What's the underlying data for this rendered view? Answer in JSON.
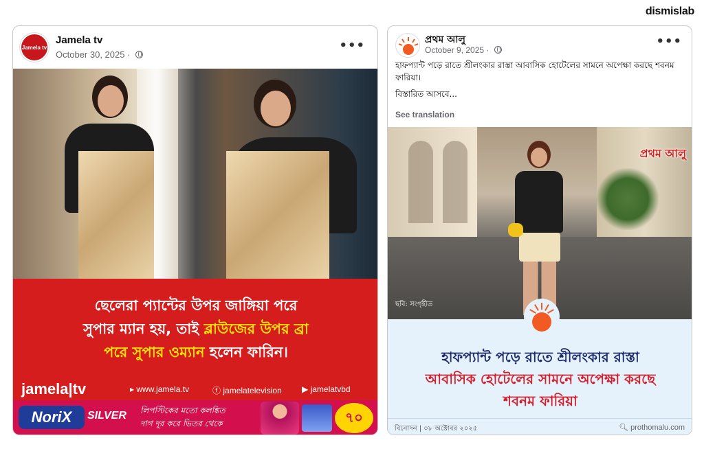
{
  "brand": "dismislab",
  "post1": {
    "page_name": "Jamela tv",
    "avatar_text": "Jamela tv",
    "date": "October 30, 2025",
    "more": "•••",
    "headline_lines": [
      [
        "ছেলেরা প্যান্টের উপর জাঙ্গিয়া পরে"
      ],
      [
        "সুপার ম্যান হয়, তাই ",
        "ব্লাউজের উপর ব্রা"
      ],
      [
        "পরে সুপার ওম্যান",
        " হলেন ফারিন।"
      ]
    ],
    "brand_bar": {
      "logo": "jamela|tv",
      "website": "www.jamela.tv",
      "facebook": "jamelatelevision",
      "youtube": "jamelatvbd"
    },
    "ad": {
      "brand": "NoriX",
      "variant": "SILVER",
      "tagline_1": "লিপস্টিকের মতো কলঙ্কিত",
      "tagline_2": "দাগ দূর করে ভিতর থেকে",
      "price": "৭০"
    }
  },
  "post2": {
    "page_name": "প্রথম আলু",
    "date": "October 9, 2025",
    "more": "•••",
    "caption": "হাফপ্যান্ট পড়ে রাতে শ্রীলংকার রাস্তা আবাসিক হোটেলের সামনে অপেক্ষা করছে শবনম ফারিয়া।",
    "caption_more": "বিস্তারিত আসবে...",
    "see_translation": "See translation",
    "watermark": "প্রথম আলু",
    "photo_credit": "ছবি: সংগৃহীত",
    "card_title_line1": "হাফপ্যান্ট পড়ে রাতে শ্রীলংকার রাস্তা",
    "card_title_line2": "আবাসিক হোটেলের সামনে অপেক্ষা করছে",
    "card_title_line3": "শবনম ফারিয়া",
    "footer_left": "বিনোদন | ০৮ অক্টোবর ২০২৫",
    "footer_right": "prothomalu.com"
  },
  "colors": {
    "jamela_red": "#d51d1d",
    "highlight_yellow": "#ffe400",
    "prothom_navy": "#1f2a6b",
    "prothom_red": "#d31f2c",
    "prothom_sun": "#f15a22",
    "prothom_bg": "#e5f1fb"
  }
}
